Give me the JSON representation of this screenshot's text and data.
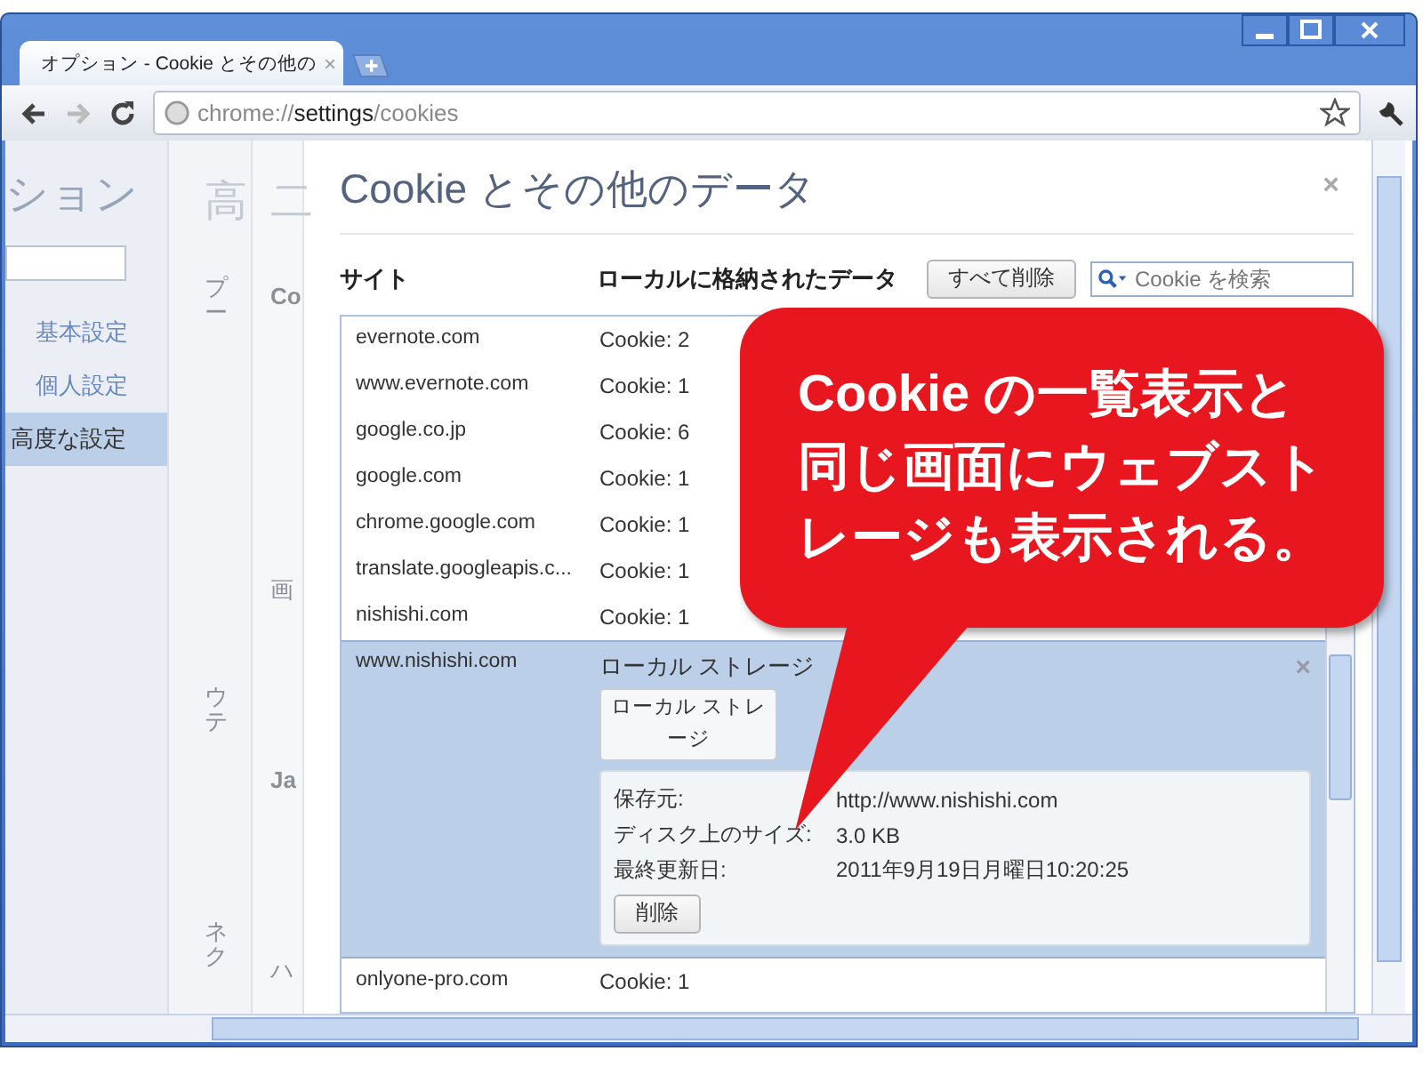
{
  "window": {
    "tab_title": "オプション - Cookie とその他の",
    "tab_close": "×"
  },
  "toolbar": {
    "url_parts": [
      {
        "text": "chrome://",
        "emphasis": false
      },
      {
        "text": "settings",
        "emphasis": true
      },
      {
        "text": "/cookies",
        "emphasis": false
      }
    ]
  },
  "sidebar": {
    "title": "ション",
    "items": [
      {
        "label": "基本設定",
        "selected": false
      },
      {
        "label": "個人設定",
        "selected": false
      },
      {
        "label": "高度な設定",
        "selected": true
      }
    ]
  },
  "background_page": {
    "column_1": [
      {
        "kind": "heading",
        "text": "高"
      },
      {
        "kind": "vertical",
        "text": "プー"
      },
      {
        "kind": "vertical",
        "text": "ウテ"
      },
      {
        "kind": "vertical",
        "text": "ネク"
      }
    ],
    "column_2": [
      {
        "kind": "heading",
        "text": "二"
      },
      {
        "kind": "bold",
        "text": "Co"
      },
      {
        "kind": "plain",
        "text": "画"
      },
      {
        "kind": "bold",
        "text": "Ja"
      },
      {
        "kind": "plain",
        "text": "ハ"
      }
    ]
  },
  "dialog": {
    "title": "Cookie とその他のデータ",
    "close": "×",
    "columns": [
      "サイト",
      "ローカルに格納されたデータ"
    ],
    "delete_all": "すべて削除",
    "search": {
      "placeholder": "Cookie を検索"
    },
    "rows": [
      {
        "site": "evernote.com",
        "data": "Cookie: 2",
        "selected": false
      },
      {
        "site": "www.evernote.com",
        "data": "Cookie: 1",
        "selected": false
      },
      {
        "site": "google.co.jp",
        "data": "Cookie: 6",
        "selected": false
      },
      {
        "site": "google.com",
        "data": "Cookie: 1",
        "selected": false
      },
      {
        "site": "chrome.google.com",
        "data": "Cookie: 1",
        "selected": false
      },
      {
        "site": "translate.googleapis.c...",
        "data": "Cookie: 1",
        "selected": false
      },
      {
        "site": "nishishi.com",
        "data": "Cookie: 1",
        "selected": false
      },
      {
        "site": "www.nishishi.com",
        "data": "ローカル ストレージ",
        "selected": true,
        "remove": "×",
        "item_button": "ローカル ストレージ",
        "details": [
          {
            "label": "保存元:",
            "value": "http://www.nishishi.com"
          },
          {
            "label": "ディスク上のサイズ:",
            "value": "3.0 KB"
          },
          {
            "label": "最終更新日:",
            "value": "2011年9月19日月曜日10:20:25"
          }
        ],
        "delete": "削除"
      },
      {
        "site": "onlyone-pro.com",
        "data": "Cookie: 1",
        "selected": false
      }
    ]
  },
  "callout": {
    "lines": [
      "Cookie の一覧表示と",
      "同じ画面にウェブスト",
      "レージも表示される。"
    ]
  }
}
